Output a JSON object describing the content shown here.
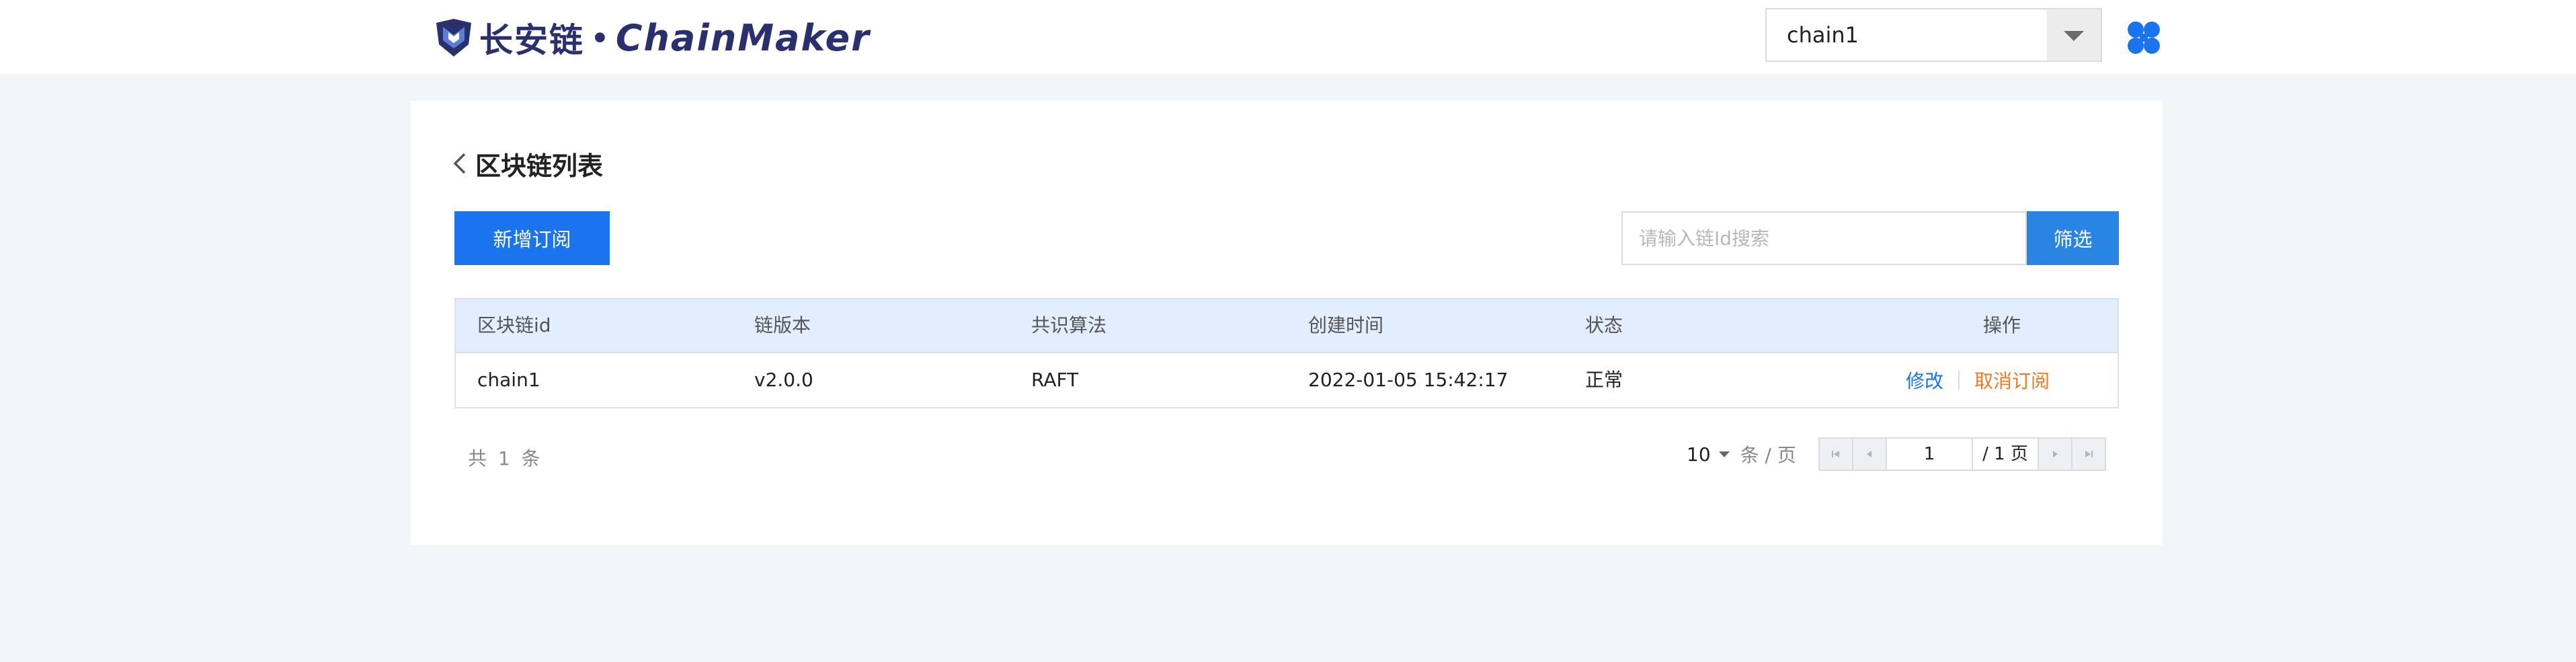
{
  "header": {
    "logo_cn": "长安链",
    "logo_dot": "•",
    "logo_en": "ChainMaker",
    "chain_select_value": "chain1"
  },
  "main": {
    "title": "区块链列表",
    "add_button_label": "新增订阅",
    "search_placeholder": "请输入链Id搜索",
    "filter_button_label": "筛选",
    "table": {
      "columns": [
        "区块链id",
        "链版本",
        "共识算法",
        "创建时间",
        "状态",
        "操作"
      ],
      "rows": [
        {
          "chain_id": "chain1",
          "version": "v2.0.0",
          "consensus": "RAFT",
          "created_at": "2022-01-05 15:42:17",
          "status": "正常",
          "action_edit": "修改",
          "action_cancel": "取消订阅"
        }
      ]
    },
    "pagination": {
      "total_text": "共 1 条",
      "page_size": "10",
      "page_size_unit": "条 / 页",
      "current_page": "1",
      "total_pages_text": "/ 1 页"
    }
  },
  "colors": {
    "primary": "#1b74ee",
    "status_ok": "#1ea64a",
    "cancel": "#f07a24",
    "table_header_bg": "#e2eefd",
    "brand_navy": "#2a2f6e"
  }
}
